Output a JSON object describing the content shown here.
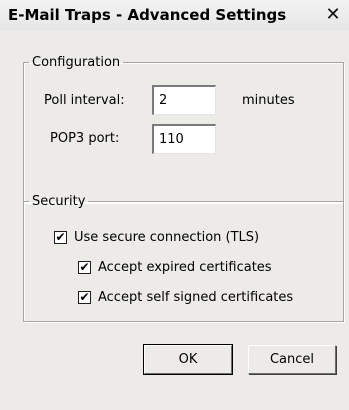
{
  "window": {
    "title": "E-Mail Traps - Advanced Settings",
    "close_glyph": "✕"
  },
  "configuration": {
    "legend": "Configuration",
    "poll_interval": {
      "label": "Poll interval:",
      "value": "2",
      "unit": "minutes"
    },
    "pop3_port": {
      "label": "POP3 port:",
      "value": "110"
    }
  },
  "security": {
    "legend": "Security",
    "use_tls": {
      "label": "Use secure connection (TLS)",
      "checked": true,
      "mark": "✔"
    },
    "accept_expired": {
      "label": "Accept expired certificates",
      "checked": true,
      "mark": "✔"
    },
    "accept_self_signed": {
      "label": "Accept self signed certificates",
      "checked": true,
      "mark": "✔"
    }
  },
  "buttons": {
    "ok": "OK",
    "cancel": "Cancel"
  }
}
